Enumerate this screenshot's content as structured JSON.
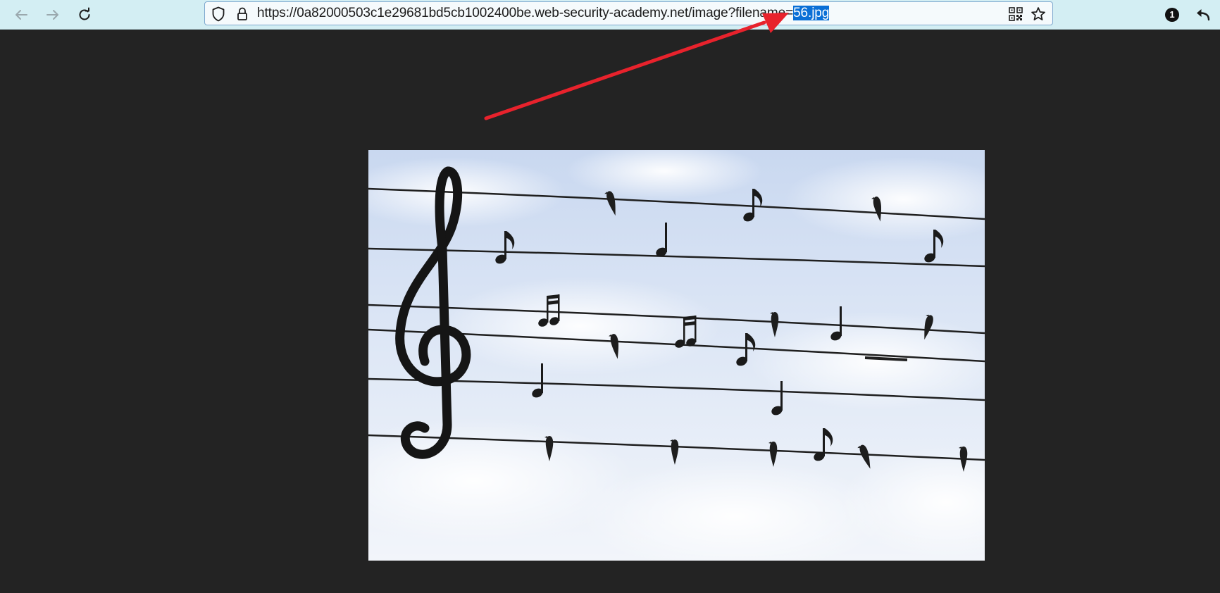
{
  "browser": {
    "url_prefix": "https://0a82000503c1e29681bd5cb1002400be.web-security-academy.net/image?filename=",
    "url_selected": "56.jpg",
    "extension_badge_count": "1",
    "icons": {
      "back": "arrow-left-icon",
      "forward": "arrow-right-icon",
      "reload": "reload-icon",
      "tracking_protection": "shield-icon",
      "lock": "lock-icon",
      "qr": "qr-code-icon",
      "bookmark": "star-icon",
      "undo": "undo-arrow-icon"
    }
  },
  "viewer": {
    "image_subject": "treble clef and musical notes with birds on power lines against cloudy sky"
  },
  "annotation": {
    "color": "#e8222c",
    "points_to": "url-filename-parameter"
  }
}
